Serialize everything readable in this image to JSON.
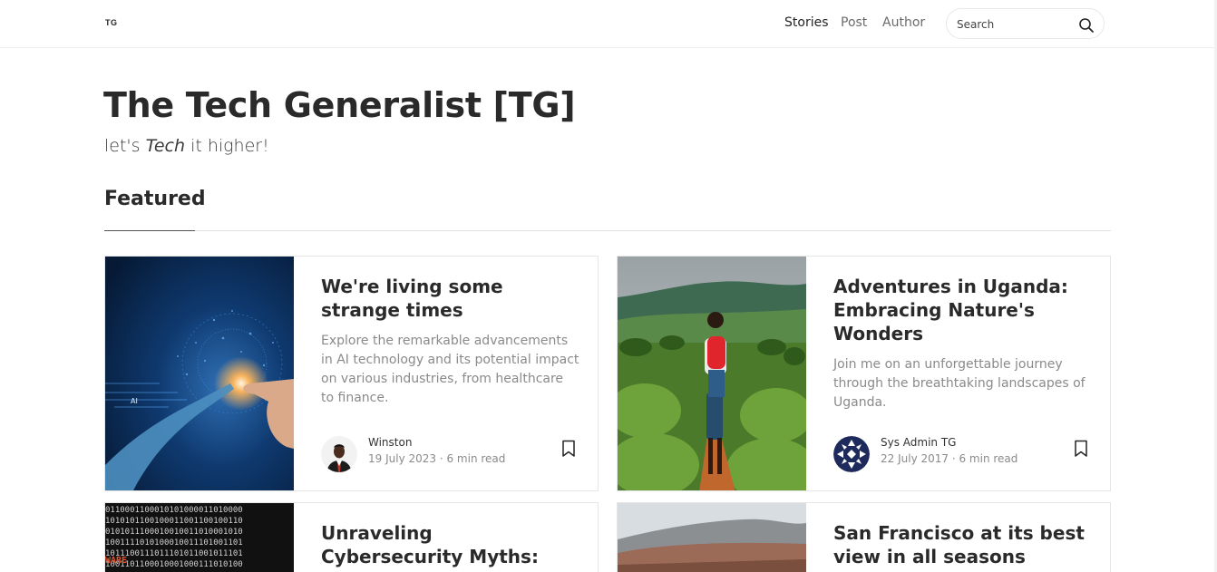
{
  "header": {
    "logo": "TG",
    "nav": [
      "Stories",
      "Post",
      "Author"
    ],
    "active_nav": "Stories",
    "search": {
      "placeholder": "Search",
      "icon": "search-icon"
    }
  },
  "hero": {
    "title": "The Tech Generalist [TG]",
    "tagline_before": "let's ",
    "tagline_emph": "Tech",
    "tagline_after": " it higher!"
  },
  "featured": {
    "heading": "Featured",
    "posts": [
      {
        "title": "We're living some strange times",
        "excerpt": "Explore the remarkable advancements in AI technology and its potential impact on various industries, from healthcare to finance.",
        "author": "Winston",
        "date": "19 July 2023",
        "read_time": "6 min read",
        "image_text": "AI"
      },
      {
        "title": "Adventures in Uganda: Embracing Nature's Wonders",
        "excerpt": "Join me on an unforgettable journey through the breathtaking landscapes of Uganda.",
        "author": "Sys Admin TG",
        "date": "22 July 2017",
        "read_time": "6 min read"
      },
      {
        "title": "Unraveling Cybersecurity Myths: Debunking the Top",
        "image_text": "WARE"
      },
      {
        "title": "San Francisco at its best view in all seasons"
      }
    ]
  },
  "colors": {
    "text": "#242424",
    "muted": "#8a8a8a",
    "border": "#e6e6e6"
  }
}
